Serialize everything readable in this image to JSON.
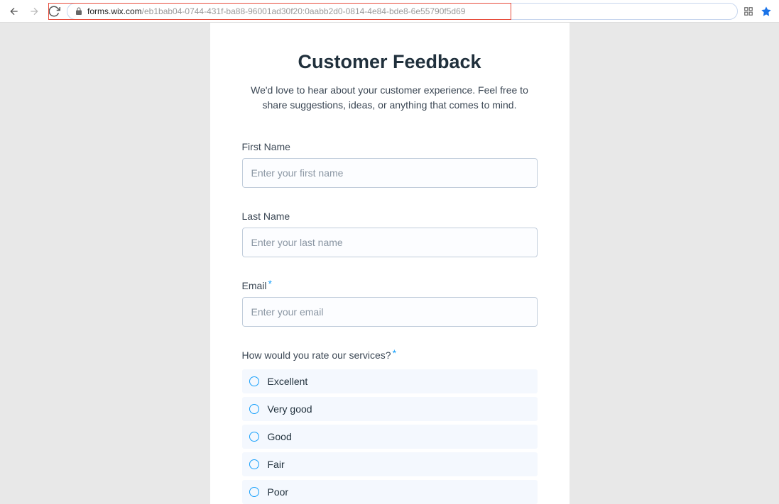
{
  "chrome": {
    "url_domain": "forms.wix.com",
    "url_path": "/eb1bab04-0744-431f-ba88-96001ad30f20:0aabb2d0-0814-4e84-bde8-6e55790f5d69"
  },
  "form": {
    "title": "Customer Feedback",
    "subtitle": "We'd love to hear about your customer experience. Feel free to share suggestions, ideas, or anything that comes to mind.",
    "fields": {
      "first_name": {
        "label": "First Name",
        "placeholder": "Enter your first name"
      },
      "last_name": {
        "label": "Last Name",
        "placeholder": "Enter your last name"
      },
      "email": {
        "label": "Email",
        "placeholder": "Enter your email"
      },
      "rating": {
        "label": "How would you rate our services?",
        "options": [
          "Excellent",
          "Very good",
          "Good",
          "Fair",
          "Poor"
        ]
      }
    }
  }
}
